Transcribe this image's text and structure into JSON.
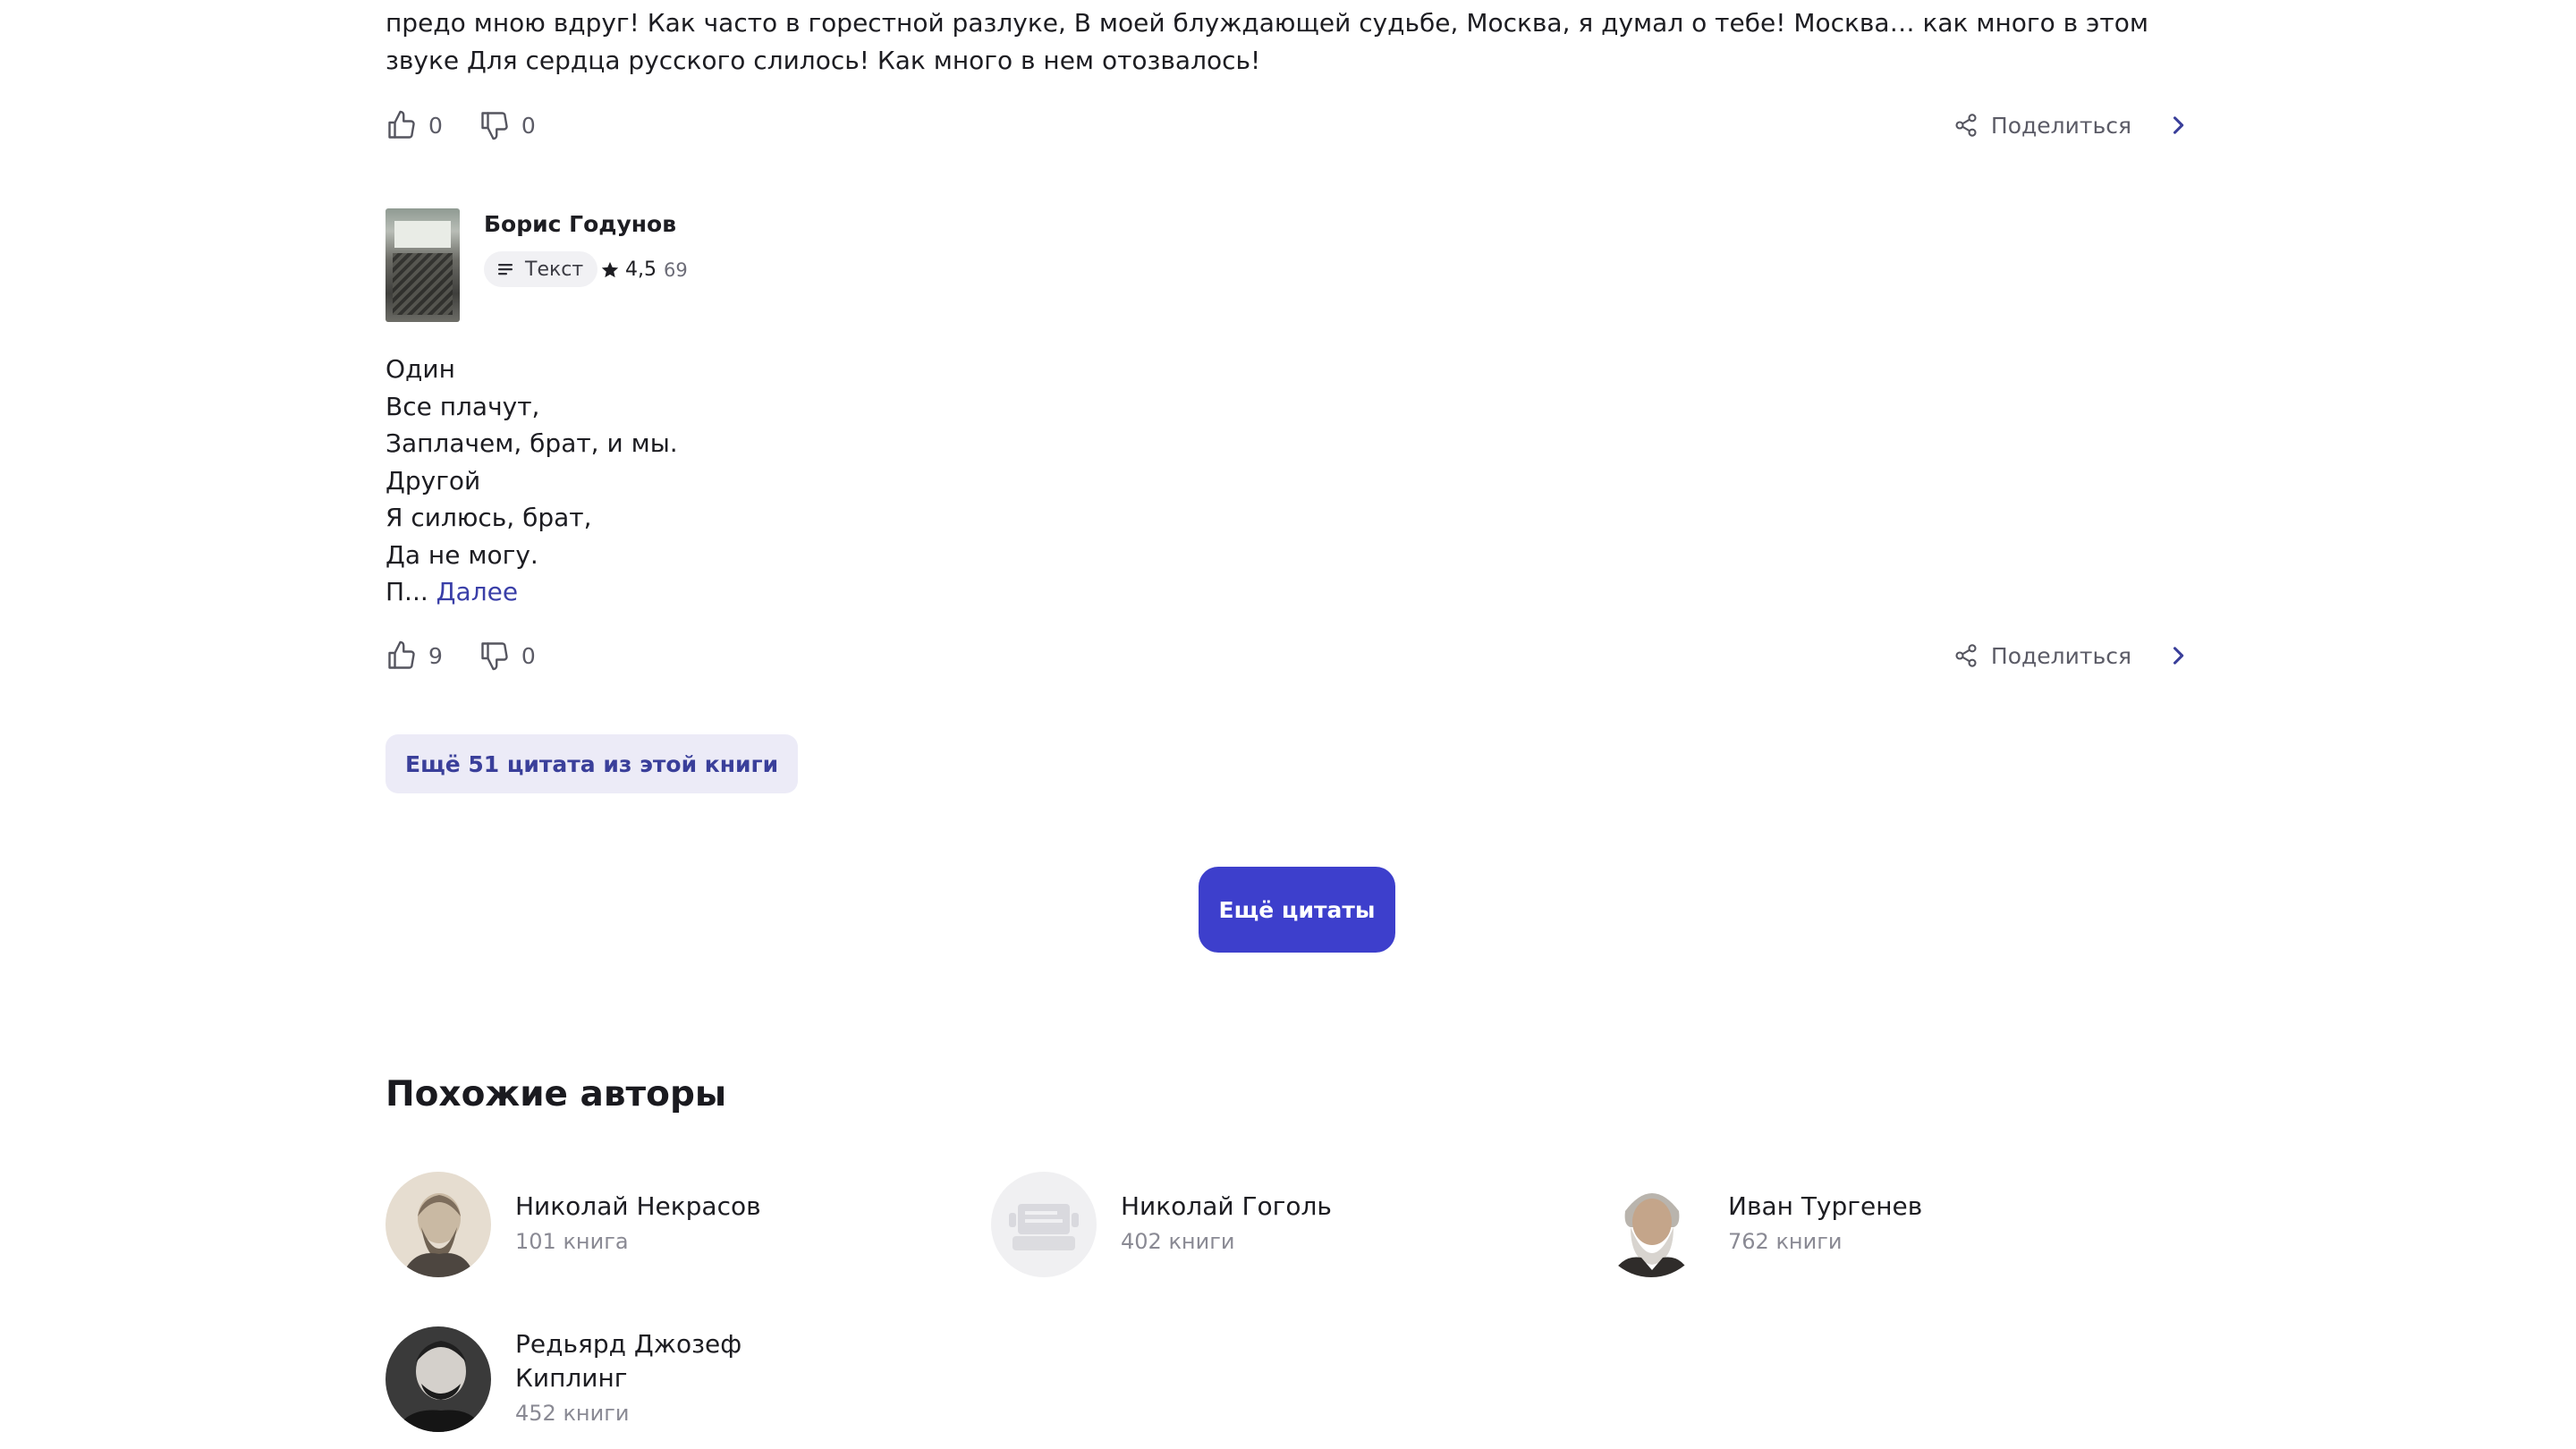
{
  "quote1": {
    "text": "предо мною вдруг! Как часто в горестной разлуке, В моей блуждающей судьбе, Москва, я думал о тебе! Москва… как много в этом звуке Для сердца русского слилось! Как много в нем отозвалось!",
    "likes": "0",
    "dislikes": "0",
    "share_label": "Поделиться"
  },
  "quote2": {
    "book_title": "Борис Годунов",
    "badge_label": "Текст",
    "rating": "4,5",
    "rating_votes": "69",
    "lines": [
      "Один",
      "Все плачут,",
      "Заплачем, брат, и мы.",
      "Другой",
      "Я силюсь, брат,",
      "Да не могу."
    ],
    "last_line_start": "П...",
    "more_link": "Далее",
    "likes": "9",
    "dislikes": "0",
    "share_label": "Поделиться"
  },
  "more_from_book_label": "Ещё 51 цитата из этой книги",
  "more_quotes_label": "Ещё цитаты",
  "similar_authors": {
    "title": "Похожие авторы",
    "items": [
      {
        "name": "Николай Некрасов",
        "count": "101 книга"
      },
      {
        "name": "Николай Гоголь",
        "count": "402 книги"
      },
      {
        "name": "Иван Тургенев",
        "count": "762 книги"
      },
      {
        "name": "Редьярд Джозеф Киплинг",
        "count": "452 книги"
      }
    ]
  },
  "icons": {
    "like": "thumbs-up-icon",
    "dislike": "thumbs-down-icon",
    "share": "share-icon",
    "chevron": "chevron-right-icon",
    "badge": "text-lines-icon",
    "rating": "star-icon"
  },
  "colors": {
    "accent": "#3d3fcc",
    "link": "#3a3fa8",
    "chip_bg": "#ecebf7",
    "muted_text": "#5b5b66"
  }
}
